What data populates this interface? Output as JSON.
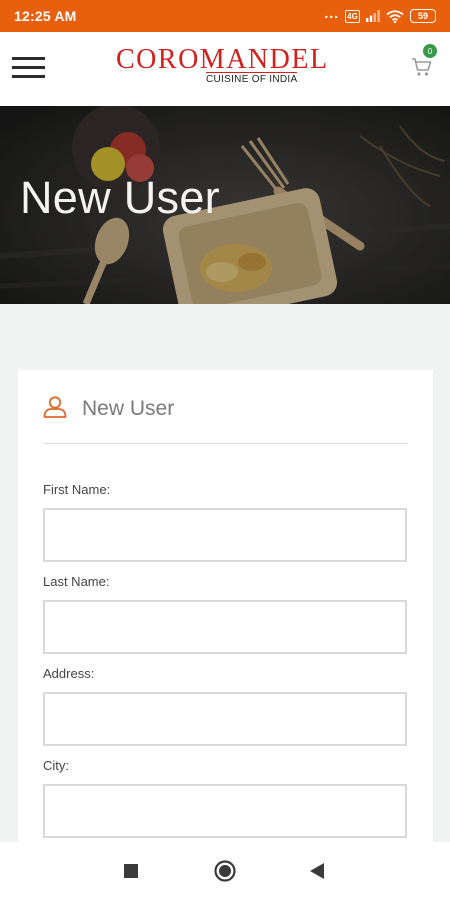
{
  "status_bar": {
    "time": "12:25 AM",
    "dots": "...",
    "sim": "4G",
    "battery": "59"
  },
  "header": {
    "logo_name": "COROMANDEL",
    "logo_tagline": "CUISINE OF INDIA",
    "cart_count": "0"
  },
  "hero": {
    "title": "New User"
  },
  "form": {
    "title": "New User",
    "fields": [
      {
        "label": "First Name:",
        "value": ""
      },
      {
        "label": "Last Name:",
        "value": ""
      },
      {
        "label": "Address:",
        "value": ""
      },
      {
        "label": "City:",
        "value": ""
      }
    ]
  },
  "icons": {
    "menu": "hamburger-icon",
    "cart": "cart-icon",
    "user": "user-icon",
    "recents": "square-icon",
    "home": "circle-icon",
    "back": "triangle-back-icon"
  },
  "colors": {
    "status_bar": "#e8600e",
    "brand_red": "#d3201d",
    "accent_orange": "#e06a2c",
    "cart_badge": "#3a9a4a"
  }
}
